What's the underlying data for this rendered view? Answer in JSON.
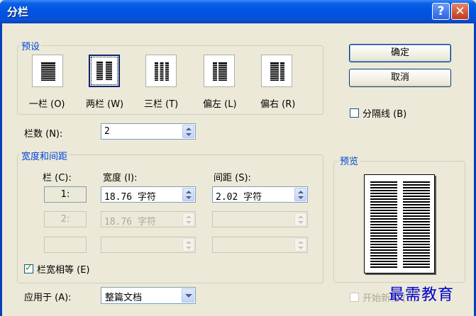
{
  "window": {
    "title": "分栏",
    "help_glyph": "?",
    "close_glyph": "✕"
  },
  "presets": {
    "group_label": "预设",
    "items": [
      {
        "label": "一栏 (O)",
        "icon": "one-column-icon"
      },
      {
        "label": "两栏 (W)",
        "icon": "two-columns-icon",
        "selected": true
      },
      {
        "label": "三栏 (T)",
        "icon": "three-columns-icon"
      },
      {
        "label": "偏左 (L)",
        "icon": "left-column-icon"
      },
      {
        "label": "偏右 (R)",
        "icon": "right-column-icon"
      }
    ]
  },
  "buttons": {
    "ok": "确定",
    "cancel": "取消"
  },
  "separator_line": {
    "label": "分隔线 (B)",
    "checked": false
  },
  "column_count": {
    "label": "栏数 (N):",
    "value": "2"
  },
  "width_spacing": {
    "group_label": "宽度和间距",
    "col_header": "栏 (C):",
    "width_header": "宽度 (I):",
    "spacing_header": "间距 (S):",
    "rows": [
      {
        "col": "1:",
        "width": "18.76 字符",
        "spacing": "2.02 字符"
      },
      {
        "col": "2:",
        "width": "18.76 字符",
        "spacing": ""
      },
      {
        "col": "",
        "width": "",
        "spacing": ""
      }
    ]
  },
  "equal_width": {
    "label": "栏宽相等 (E)",
    "checked": true
  },
  "preview": {
    "group_label": "预览"
  },
  "apply_to": {
    "label": "应用于 (A):",
    "value": "整篇文档"
  },
  "start_new_column": {
    "label": "开始新栏 (U)",
    "checked": false,
    "enabled": false
  },
  "watermark": "最需教育"
}
